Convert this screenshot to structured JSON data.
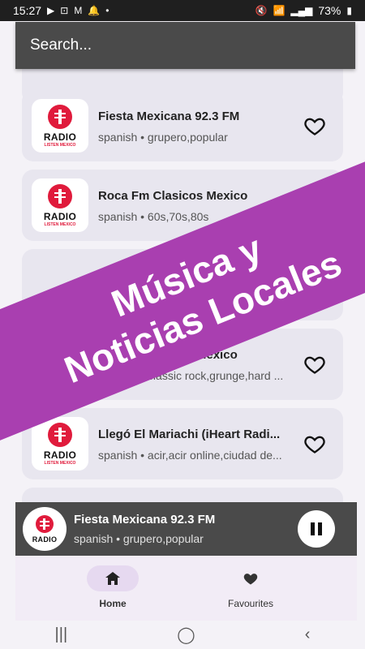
{
  "status": {
    "time": "15:27",
    "battery": "73%"
  },
  "search": {
    "placeholder": "Search..."
  },
  "stations": [
    {
      "name": "Fiesta Mexicana 92.3 FM",
      "tags": "spanish • grupero,popular"
    },
    {
      "name": "Roca Fm Clasicos Mexico",
      "tags": "spanish • 60s,70s,80s"
    },
    {
      "name": "",
      "tags": ""
    },
    {
      "name": "Rock 101 Online Mexico",
      "tags": "spanish • classic rock,grunge,hard ..."
    },
    {
      "name": "Llegó El Mariachi (iHeart Radi...",
      "tags": "spanish • acir,acir online,ciudad de..."
    }
  ],
  "logo": {
    "label": "RADIO",
    "sublabel": "LISTEN MEXICO"
  },
  "banner": {
    "line1": "Música y",
    "line2": "Noticias Locales"
  },
  "player": {
    "title": "Fiesta Mexicana 92.3 FM",
    "subtitle": "spanish • grupero,popular"
  },
  "nav": {
    "home": "Home",
    "favourites": "Favourites"
  },
  "colors": {
    "accent": "#a93fb0",
    "logo_red": "#e01b3c"
  }
}
